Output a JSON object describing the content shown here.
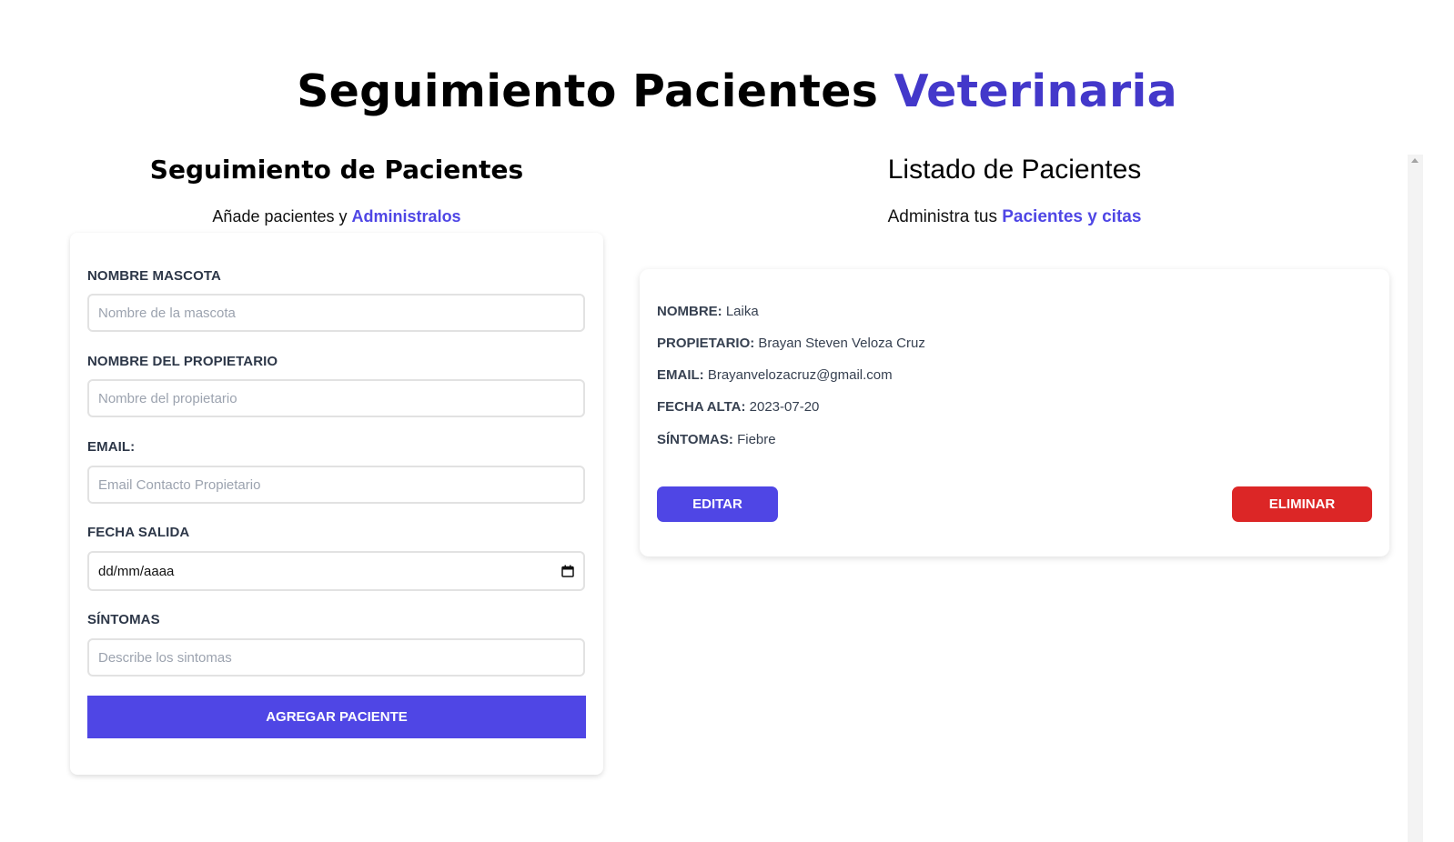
{
  "header": {
    "title_main": "Seguimiento Pacientes",
    "title_accent": "Veterinaria"
  },
  "form_section": {
    "heading": "Seguimiento de Pacientes",
    "subtitle_plain": "Añade pacientes y",
    "subtitle_accent": "Administralos",
    "fields": {
      "pet_name": {
        "label": "NOMBRE MASCOTA",
        "placeholder": "Nombre de la mascota",
        "value": ""
      },
      "owner_name": {
        "label": "NOMBRE DEL PROPIETARIO",
        "placeholder": "Nombre del propietario",
        "value": ""
      },
      "email": {
        "label": "EMAIL:",
        "placeholder": "Email Contacto Propietario",
        "value": ""
      },
      "discharge_date": {
        "label": "FECHA SALIDA",
        "display": "dd/mm/aaaa"
      },
      "symptoms": {
        "label": "SÍNTOMAS",
        "placeholder": "Describe los sintomas",
        "value": ""
      }
    },
    "submit_label": "AGREGAR PACIENTE"
  },
  "list_section": {
    "heading": "Listado de Pacientes",
    "subtitle_plain": "Administra tus",
    "subtitle_accent": "Pacientes y citas",
    "patients": [
      {
        "name_key": "NOMBRE:",
        "name": "Laika",
        "owner_key": "PROPIETARIO:",
        "owner": "Brayan Steven Veloza Cruz",
        "email_key": "EMAIL:",
        "email": "Brayanvelozacruz@gmail.com",
        "date_key": "FECHA ALTA:",
        "date": "2023-07-20",
        "symptoms_key": "SÍNTOMAS:",
        "symptoms": "Fiebre",
        "edit_label": "EDITAR",
        "delete_label": "ELIMINAR"
      }
    ]
  },
  "colors": {
    "accent": "#4f46e5",
    "accent_dark": "#4338ca",
    "danger": "#dc2626"
  },
  "icons": {
    "date_picker": "calendar-icon",
    "scroll_up": "scroll-up-arrow-icon"
  }
}
